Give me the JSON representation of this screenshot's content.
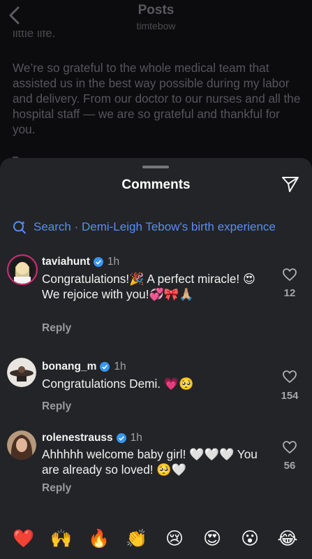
{
  "header": {
    "title": "Posts",
    "subtitle": "timtebow"
  },
  "post": {
    "partial_line": "little life.",
    "caption": "We’re so grateful to the whole medical team that assisted us in the best way possible during my labor and delivery. From our doctor to our nurses and all the hospital staff — we are so grateful and thankful for you."
  },
  "sheet": {
    "title": "Comments",
    "search_label": "Search · Demi-Leigh Tebow's birth experience"
  },
  "comments": [
    {
      "username": "taviahunt",
      "time": "1h",
      "text": "Congratulations!🎉 A perfect miracle! 😍 We rejoice with you!💞🎀🙏🏼",
      "likes": "12",
      "reply": "Reply"
    },
    {
      "username": "bonang_m",
      "time": "1h",
      "text": "Congratulations Demi. 💗🥺",
      "likes": "154",
      "reply": "Reply"
    },
    {
      "username": "rolenestrauss",
      "time": "1h",
      "text": "Ahhhhh welcome baby girl! 🤍🤍🤍 You are already so loved! 🥺🤍",
      "likes": "56",
      "reply": "Reply"
    }
  ],
  "emoji_bar": [
    "❤️",
    "🙌",
    "🔥",
    "👏",
    "😢",
    "😍",
    "😮",
    "😂"
  ],
  "colors": {
    "accent_blue": "#5b8cf6",
    "verified_blue": "#3897f0",
    "sheet_bg": "#232427"
  }
}
